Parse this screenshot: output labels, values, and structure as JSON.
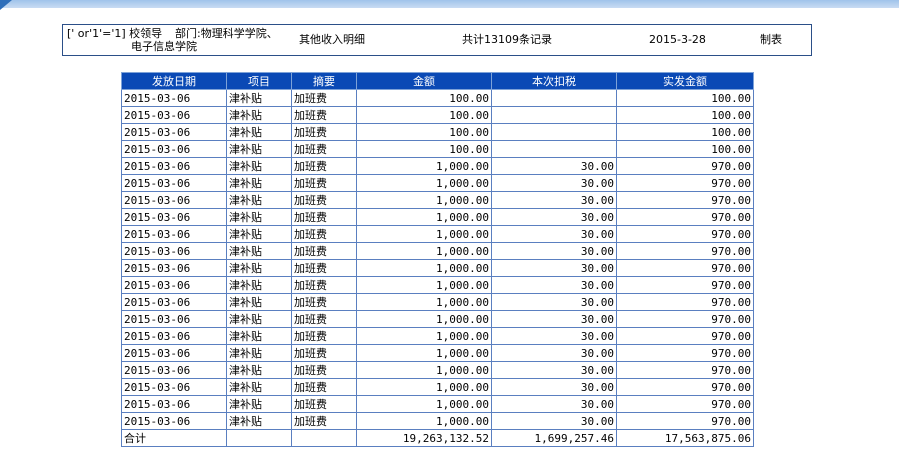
{
  "header": {
    "condition": "[' or'1'='1] 校领导",
    "dept_line1": "部门:物理科学学院、",
    "dept_line2": "电子信息学院",
    "title": "其他收入明细",
    "total_records": "共计13109条记录",
    "date": "2015-3-28",
    "maker_label": "制表"
  },
  "table": {
    "columns": [
      "发放日期",
      "项目",
      "摘要",
      "金额",
      "本次扣税",
      "实发金额"
    ],
    "rows": [
      [
        "2015-03-06",
        "津补贴",
        "加班费",
        "100.00",
        "",
        "100.00"
      ],
      [
        "2015-03-06",
        "津补贴",
        "加班费",
        "100.00",
        "",
        "100.00"
      ],
      [
        "2015-03-06",
        "津补贴",
        "加班费",
        "100.00",
        "",
        "100.00"
      ],
      [
        "2015-03-06",
        "津补贴",
        "加班费",
        "100.00",
        "",
        "100.00"
      ],
      [
        "2015-03-06",
        "津补贴",
        "加班费",
        "1,000.00",
        "30.00",
        "970.00"
      ],
      [
        "2015-03-06",
        "津补贴",
        "加班费",
        "1,000.00",
        "30.00",
        "970.00"
      ],
      [
        "2015-03-06",
        "津补贴",
        "加班费",
        "1,000.00",
        "30.00",
        "970.00"
      ],
      [
        "2015-03-06",
        "津补贴",
        "加班费",
        "1,000.00",
        "30.00",
        "970.00"
      ],
      [
        "2015-03-06",
        "津补贴",
        "加班费",
        "1,000.00",
        "30.00",
        "970.00"
      ],
      [
        "2015-03-06",
        "津补贴",
        "加班费",
        "1,000.00",
        "30.00",
        "970.00"
      ],
      [
        "2015-03-06",
        "津补贴",
        "加班费",
        "1,000.00",
        "30.00",
        "970.00"
      ],
      [
        "2015-03-06",
        "津补贴",
        "加班费",
        "1,000.00",
        "30.00",
        "970.00"
      ],
      [
        "2015-03-06",
        "津补贴",
        "加班费",
        "1,000.00",
        "30.00",
        "970.00"
      ],
      [
        "2015-03-06",
        "津补贴",
        "加班费",
        "1,000.00",
        "30.00",
        "970.00"
      ],
      [
        "2015-03-06",
        "津补贴",
        "加班费",
        "1,000.00",
        "30.00",
        "970.00"
      ],
      [
        "2015-03-06",
        "津补贴",
        "加班费",
        "1,000.00",
        "30.00",
        "970.00"
      ],
      [
        "2015-03-06",
        "津补贴",
        "加班费",
        "1,000.00",
        "30.00",
        "970.00"
      ],
      [
        "2015-03-06",
        "津补贴",
        "加班费",
        "1,000.00",
        "30.00",
        "970.00"
      ],
      [
        "2015-03-06",
        "津补贴",
        "加班费",
        "1,000.00",
        "30.00",
        "970.00"
      ],
      [
        "2015-03-06",
        "津补贴",
        "加班费",
        "1,000.00",
        "30.00",
        "970.00"
      ]
    ],
    "total": [
      "合计",
      "",
      "",
      "19,263,132.52",
      "1,699,257.46",
      "17,563,875.06"
    ]
  },
  "colors": {
    "header_bg": "#0a49b5",
    "border": "#5a7fc0",
    "top_bar": "#9fc3ea"
  }
}
